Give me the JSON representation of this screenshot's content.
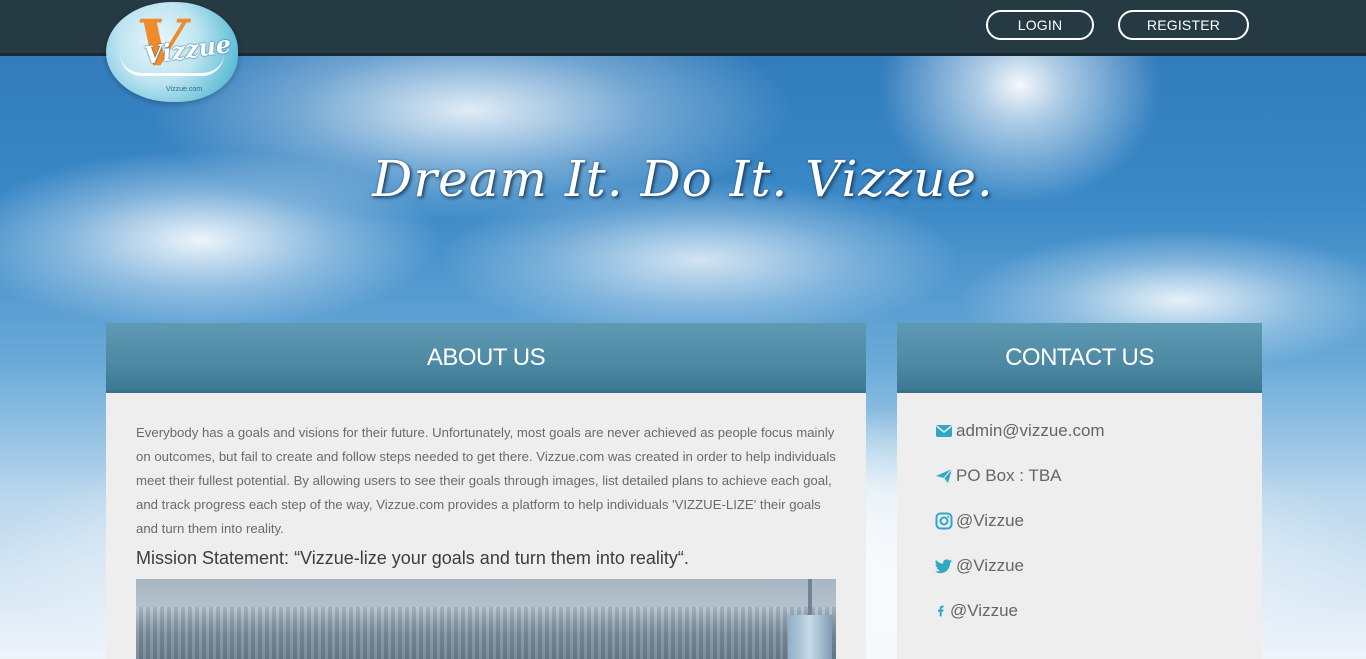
{
  "header": {
    "logo_text": "Vizzue",
    "logo_v": "V",
    "logo_small": "Vizzue.com",
    "login_label": "LOGIN",
    "register_label": "REGISTER"
  },
  "hero": {
    "tagline": "Dream It. Do It. Vizzue."
  },
  "about": {
    "title": "ABOUT US",
    "body": "Everybody has a goals and visions for their future. Unfortunately, most goals are never achieved as people focus mainly on outcomes, but fail to create and follow steps needed to get there. Vizzue.com was created in order to help individuals meet their fullest potential. By allowing users to see their goals through images, list detailed plans to achieve each goal, and track progress each step of the way, Vizzue.com provides a platform to help individuals 'VIZZUE-LIZE' their goals and turn them into reality.",
    "mission": "Mission Statement: “Vizzue-lize your goals and turn them into reality“."
  },
  "contact": {
    "title": "CONTACT US",
    "items": [
      {
        "icon": "envelope-icon",
        "label": "admin@vizzue.com"
      },
      {
        "icon": "paper-plane-icon",
        "label": "PO Box : TBA"
      },
      {
        "icon": "instagram-icon",
        "label": "@Vizzue"
      },
      {
        "icon": "twitter-icon",
        "label": "@Vizzue"
      },
      {
        "icon": "facebook-icon",
        "label": "@Vizzue"
      }
    ]
  },
  "colors": {
    "topbar": "#263a44",
    "panel_header": "#4d89a3",
    "accent_icon": "#2fa8c6",
    "logo_orange": "#f08a2a"
  }
}
